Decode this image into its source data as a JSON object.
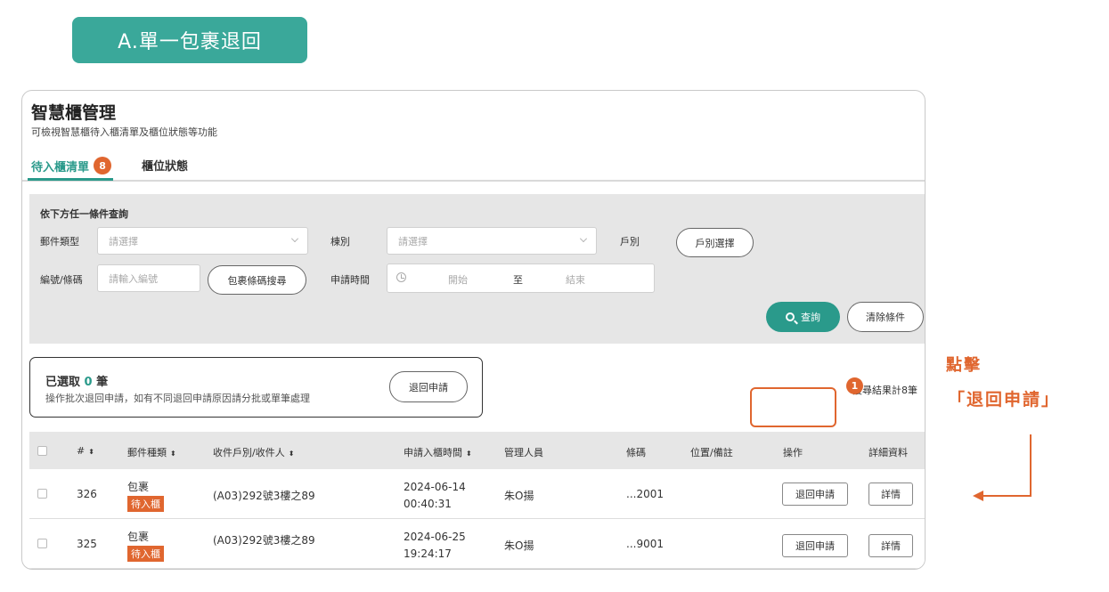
{
  "banner": "A.單一包裹退回",
  "header": {
    "title": "智慧櫃管理",
    "subtitle": "可檢視智慧櫃待入櫃清單及櫃位狀態等功能"
  },
  "tabs": [
    {
      "label": "待入櫃清單",
      "badge": "8"
    },
    {
      "label": "櫃位狀態"
    }
  ],
  "filter": {
    "title": "依下方任一條件查詢",
    "mail_type_label": "郵件類型",
    "mail_type_placeholder": "請選擇",
    "building_label": "棟別",
    "building_placeholder": "請選擇",
    "household_label": "戶別",
    "household_button": "戶別選擇",
    "code_label": "編號/條碼",
    "code_placeholder": "請輸入編號",
    "barcode_search_button": "包裹條碼搜尋",
    "apply_time_label": "申請時間",
    "start_placeholder": "開始",
    "range_sep": "至",
    "end_placeholder": "結束",
    "search_button": "查詢",
    "clear_button": "清除條件"
  },
  "selection": {
    "prefix": "已選取",
    "count": "0",
    "unit": "筆",
    "desc": "操作批次退回申請，如有不同退回申請原因請分批或單筆處理",
    "return_button": "退回申請"
  },
  "result_count": "搜尋結果計8筆",
  "table": {
    "headers": {
      "num": "#",
      "mail_type": "郵件種類",
      "recipient": "收件戶別/收件人",
      "apply_time": "申請入櫃時間",
      "manager": "管理人員",
      "barcode": "條碼",
      "location": "位置/備註",
      "action": "操作",
      "detail": "詳細資料"
    },
    "rows": [
      {
        "num": "326",
        "type": "包裹",
        "status": "待入櫃",
        "recipient": "(A03)292號3樓之89",
        "date": "2024-06-14",
        "time": "00:40:31",
        "manager": "朱O揚",
        "barcode": "...2001",
        "return_label": "退回申請",
        "detail_label": "詳情"
      },
      {
        "num": "325",
        "type": "包裹",
        "status": "待入櫃",
        "recipient": "(A03)292號3樓之89",
        "date": "2024-06-25",
        "time": "19:24:17",
        "manager": "朱O揚",
        "barcode": "...9001",
        "return_label": "退回申請",
        "detail_label": "詳情"
      }
    ]
  },
  "annotation": {
    "step": "1",
    "line1": "點擊",
    "line2": "「退回申請」"
  },
  "colors": {
    "accent": "#2a9a8b",
    "banner": "#3aa89a",
    "highlight": "#e0662f"
  }
}
